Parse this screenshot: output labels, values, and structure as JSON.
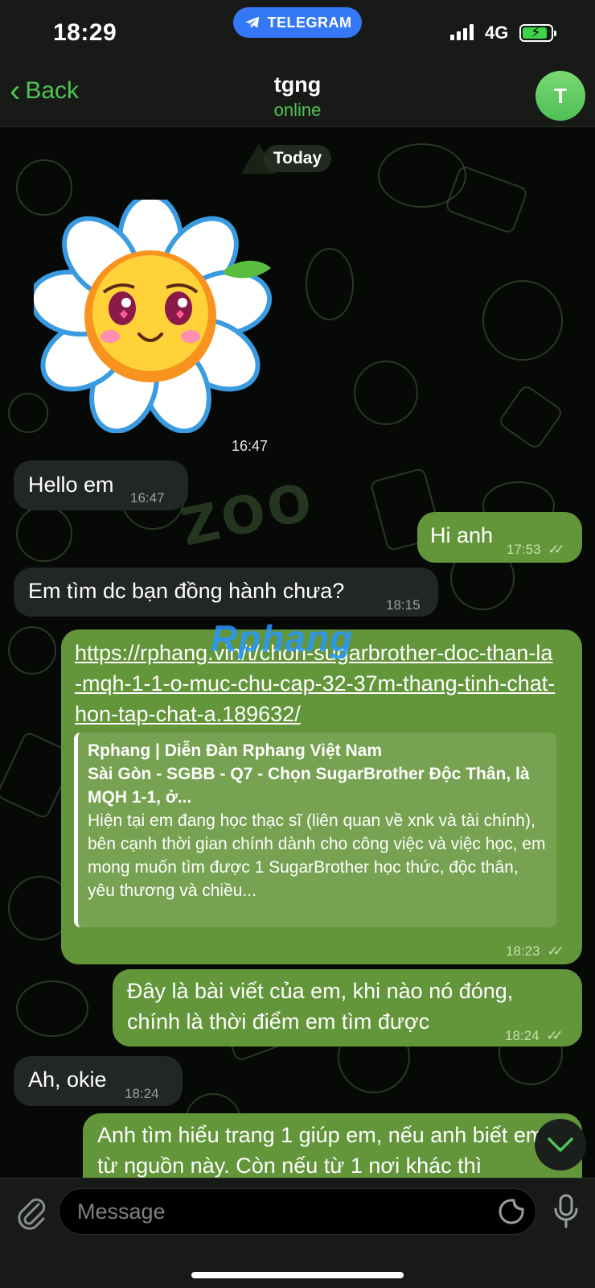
{
  "status_bar": {
    "time": "18:29",
    "app_pill": "TELEGRAM",
    "network": "4G",
    "battery_charging": true
  },
  "header": {
    "back_label": "Back",
    "title": "tgng",
    "status": "online",
    "avatar_letter": "T"
  },
  "chat": {
    "date_label": "Today",
    "sticker": {
      "icon": "smiling-daisy-sticker",
      "time": "16:47"
    },
    "messages": [
      {
        "dir": "in",
        "text": "Hello em",
        "time": "16:47"
      },
      {
        "dir": "out",
        "text": "Hi anh",
        "time": "17:53",
        "ticks": "✓✓"
      },
      {
        "dir": "in",
        "text": "Em tìm dc bạn đồng hành chưa?",
        "time": "18:15"
      },
      {
        "dir": "out",
        "link": "https://rphang.vin/t/chon-sugarbrother-doc-than-la-mqh-1-1-o-muc-chu-cap-32-37m-thang-tinh-chat-hon-tap-chat-a.189632/",
        "preview": {
          "site": "Rphang | Diễn Đàn Rphang Việt Nam",
          "title": "Sài Gòn - SGBB - Q7 - Chọn SugarBrother Độc Thân, là MQH 1-1, ở...",
          "description": "Hiện tại em đang học thạc sĩ (liên quan về xnk và tài chính), bên cạnh thời gian chính dành cho công việc và việc học, em mong muốn tìm được 1 SugarBrother học thức, độc thân, yêu thương và chiều..."
        },
        "time": "18:23",
        "ticks": "✓✓"
      },
      {
        "dir": "out",
        "text": "Đây là bài viết của em, khi nào nó đóng, chính là thời điểm em tìm được",
        "time": "18:24",
        "ticks": "✓✓"
      },
      {
        "dir": "in",
        "text": "Ah, okie",
        "time": "18:24"
      },
      {
        "dir": "out",
        "text": "Anh tìm hiểu trang 1 giúp em, nếu anh biết em từ nguồn này. Còn nếu từ 1 nơi khác thì"
      }
    ]
  },
  "watermark": {
    "part1": "Rp",
    "part2": "hang"
  },
  "input": {
    "placeholder": "Message",
    "value": ""
  },
  "colors": {
    "accent": "#4fc356",
    "outgoing": "#63963a",
    "incoming": "#222624",
    "telegram_blue": "#3478f6"
  }
}
